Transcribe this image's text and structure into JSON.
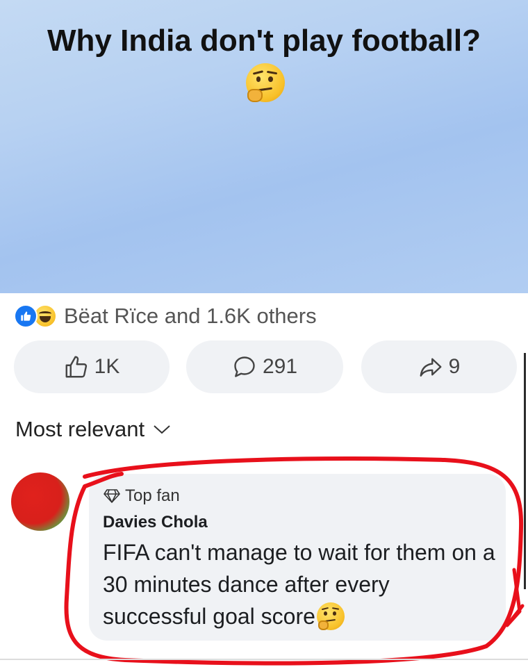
{
  "post": {
    "title": "Why India don't play football?",
    "title_emoji": "thinking-face"
  },
  "reactions": {
    "icons": [
      "like-reaction",
      "haha-reaction"
    ],
    "summary": "Bëat Rïce and 1.6K others"
  },
  "actions": {
    "like_count": "1K",
    "comment_count": "291",
    "share_count": "9"
  },
  "comments_sort": {
    "label": "Most relevant"
  },
  "top_comment": {
    "badge": "Top fan",
    "author": "Davies Chola",
    "text": "FIFA can't manage to wait for them on a 30 minutes dance after every successful goal score",
    "trailing_emoji": "thinking-face"
  },
  "colors": {
    "post_background": "#b7d1f2",
    "like_blue": "#1877f2",
    "bubble_gray": "#f0f2f5",
    "highlight_red": "#e8101b"
  }
}
